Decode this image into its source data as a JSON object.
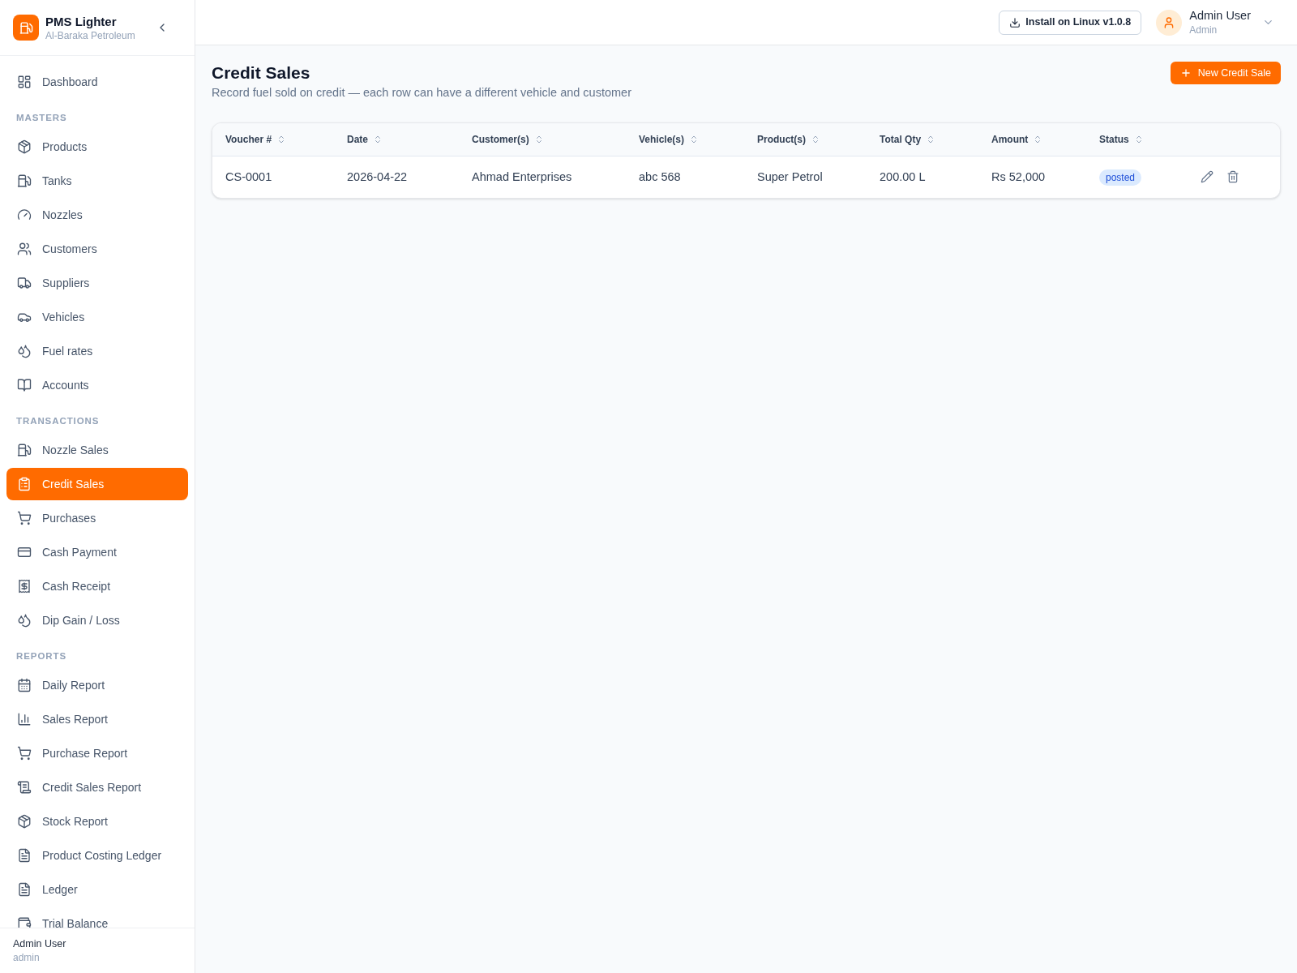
{
  "sidebar": {
    "brand": {
      "title": "PMS Lighter",
      "subtitle": "Al-Baraka Petroleum"
    },
    "top_items": [
      {
        "label": "Dashboard",
        "selected": false
      }
    ],
    "sections": [
      {
        "heading": "MASTERS",
        "items": [
          {
            "label": "Products",
            "selected": false
          },
          {
            "label": "Tanks",
            "selected": false
          },
          {
            "label": "Nozzles",
            "selected": false
          },
          {
            "label": "Customers",
            "selected": false
          },
          {
            "label": "Suppliers",
            "selected": false
          },
          {
            "label": "Vehicles",
            "selected": false
          },
          {
            "label": "Fuel rates",
            "selected": false
          },
          {
            "label": "Accounts",
            "selected": false
          }
        ]
      },
      {
        "heading": "TRANSACTIONS",
        "items": [
          {
            "label": "Nozzle Sales",
            "selected": false
          },
          {
            "label": "Credit Sales",
            "selected": true
          },
          {
            "label": "Purchases",
            "selected": false
          },
          {
            "label": "Cash Payment",
            "selected": false
          },
          {
            "label": "Cash Receipt",
            "selected": false
          },
          {
            "label": "Dip Gain / Loss",
            "selected": false
          }
        ]
      },
      {
        "heading": "REPORTS",
        "items": [
          {
            "label": "Daily Report",
            "selected": false
          },
          {
            "label": "Sales Report",
            "selected": false
          },
          {
            "label": "Purchase Report",
            "selected": false
          },
          {
            "label": "Credit Sales Report",
            "selected": false
          },
          {
            "label": "Stock Report",
            "selected": false
          },
          {
            "label": "Product Costing Ledger",
            "selected": false
          },
          {
            "label": "Ledger",
            "selected": false
          },
          {
            "label": "Trial Balance",
            "selected": false
          }
        ]
      }
    ],
    "footer": {
      "name": "Admin User",
      "role": "admin"
    }
  },
  "top_bar": {
    "install_button": "Install on Linux v1.0.8",
    "user": {
      "name": "Admin User",
      "role": "Admin"
    }
  },
  "page": {
    "title": "Credit Sales",
    "subtitle": "Record fuel sold on credit — each row can have a different vehicle and customer",
    "new_button": "New Credit Sale"
  },
  "table": {
    "columns": [
      "Voucher #",
      "Date",
      "Customer(s)",
      "Vehicle(s)",
      "Product(s)",
      "Total Qty",
      "Amount",
      "Status"
    ],
    "rows": [
      {
        "cells": [
          "CS-0001",
          "2026-04-22",
          "Ahmad Enterprises",
          "abc 568",
          "Super Petrol",
          "200.00 L",
          "Rs 52,000"
        ],
        "status": "posted"
      }
    ]
  }
}
